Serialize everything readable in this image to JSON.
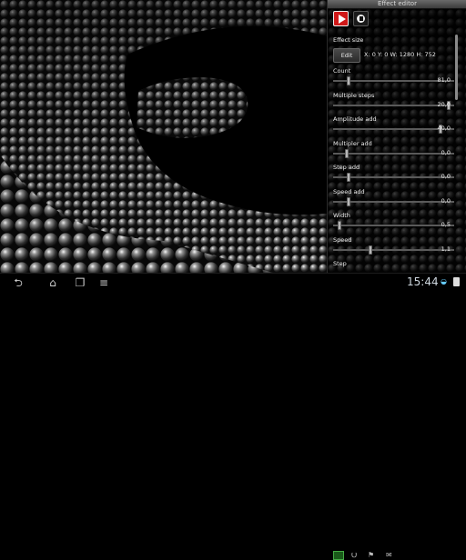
{
  "panel": {
    "title": "Effect editor",
    "effect_size_label": "Effect size",
    "edit_label": "Edit",
    "effect_size_value": "X: 0 Y: 0 W: 1280 H: 752",
    "sliders": [
      {
        "label": "Count",
        "value": "81,0",
        "position": 0.12
      },
      {
        "label": "Multiple steps",
        "value": "20,0",
        "position": 0.97
      },
      {
        "label": "Amplitude add",
        "value": "40,0",
        "position": 0.9
      },
      {
        "label": "Multipler add",
        "value": "0,0",
        "position": 0.1
      },
      {
        "label": "Step add",
        "value": "0,0",
        "position": 0.12
      },
      {
        "label": "Speed add",
        "value": "0,0",
        "position": 0.12
      },
      {
        "label": "Width",
        "value": "0,5",
        "position": 0.04
      },
      {
        "label": "Speed",
        "value": "1,1",
        "position": 0.3
      },
      {
        "label": "Step",
        "value": "",
        "position": null
      }
    ]
  },
  "statusbar": {
    "clock": "15:44"
  },
  "icons": {
    "play": "play-icon",
    "pause": "pause-icon",
    "back": "back-icon",
    "home": "home-icon",
    "recent": "recent-apps-icon",
    "menu": "menu-icon",
    "usb": "usb-icon",
    "mail": "mail-icon",
    "wifi": "wifi-icon",
    "battery": "battery-icon"
  },
  "colors": {
    "play_red": "#d01818",
    "clock": "#cfd8e0"
  }
}
